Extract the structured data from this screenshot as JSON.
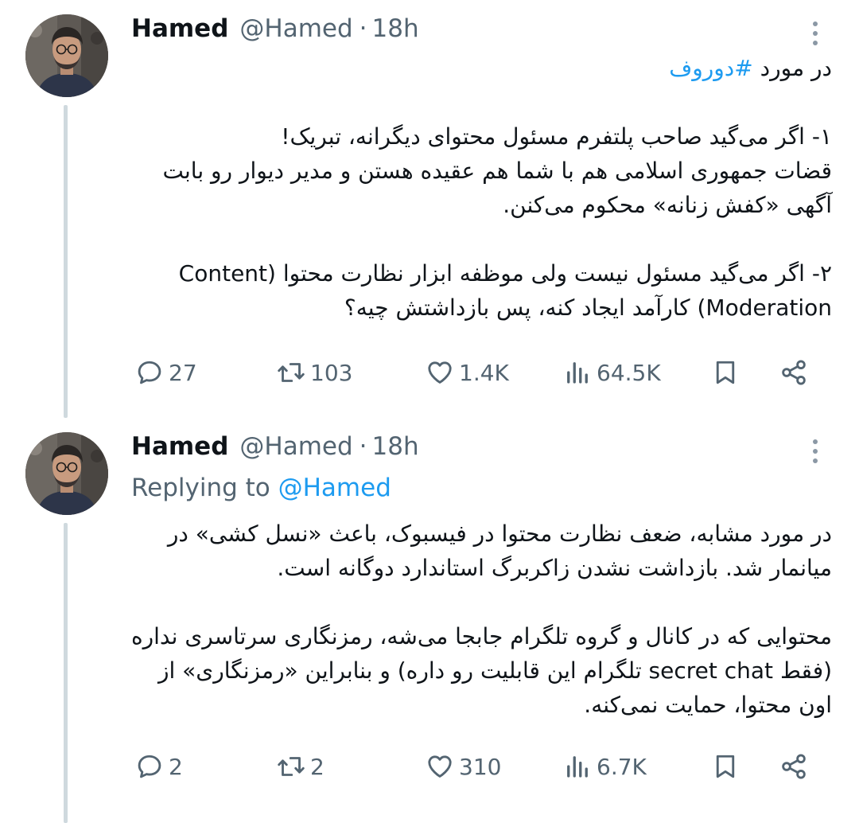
{
  "tweets": [
    {
      "author": {
        "name": "Hamed",
        "handle": "@Hamed",
        "separator": "·",
        "time": "18h"
      },
      "hashtag_prefix": "در مورد ",
      "hashtag": "#دوروف",
      "paragraphs": [
        [
          "۱- اگر می‌گید صاحب پلتفرم مسئول محتوای دیگرانه، تبریک!",
          "قضات جمهوری اسلامی هم با شما هم عقیده هستن و مدیر دیوار رو بابت",
          "آگهی «کفش زنانه» محکوم می‌کنن."
        ],
        [
          "۲- اگر می‌گید مسئول نیست ولی موظفه ابزار نظارت محتوا (Content",
          "Moderation) کارآمد ایجاد کنه، پس بازداشتش چیه؟"
        ]
      ],
      "stats": {
        "replies": "27",
        "retweets": "103",
        "likes": "1.4K",
        "views": "64.5K"
      }
    },
    {
      "author": {
        "name": "Hamed",
        "handle": "@Hamed",
        "separator": "·",
        "time": "18h"
      },
      "replying_label": "Replying to ",
      "replying_to": "@Hamed",
      "paragraphs": [
        [
          "در مورد مشابه، ضعف نظارت محتوا در فیسبوک، باعث «نسل کشی» در",
          "میانمار شد. بازداشت نشدن زاکربرگ استاندارد دوگانه است."
        ],
        [
          "محتوایی که در کانال و گروه تلگرام جابجا می‌شه، رمزنگاری سرتاسری نداره",
          "(فقط secret chat تلگرام این قابلیت رو داره) و بنابراین «رمزنگاری» از",
          "اون محتوا، حمایت نمی‌کنه."
        ]
      ],
      "stats": {
        "replies": "2",
        "retweets": "2",
        "likes": "310",
        "views": "6.7K"
      }
    }
  ],
  "icons": {
    "reply": "reply-icon",
    "retweet": "retweet-icon",
    "like": "heart-icon",
    "views": "views-icon",
    "bookmark": "bookmark-icon",
    "share": "share-icon",
    "more": "more-icon"
  },
  "colors": {
    "link": "#1d9bf0",
    "secondary": "#536471",
    "text": "#0f1419",
    "thread_line": "#cfd9de"
  }
}
